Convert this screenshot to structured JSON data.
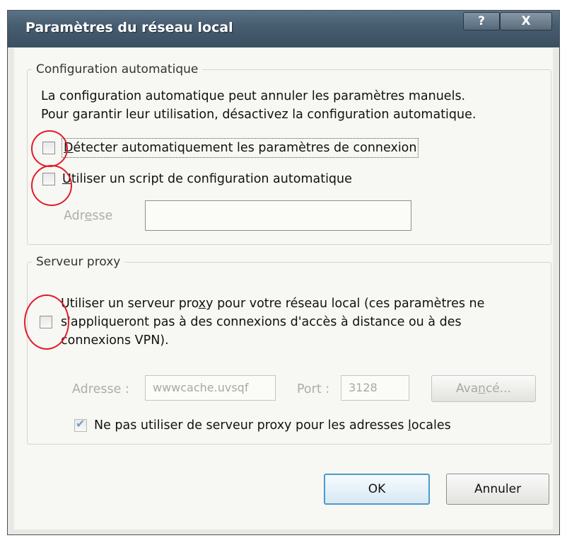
{
  "window": {
    "title": "Paramètres du réseau local",
    "help_label": "?",
    "close_label": "X"
  },
  "auto_config": {
    "legend": "Configuration automatique",
    "description_line1": "La configuration automatique peut annuler les paramètres manuels.",
    "description_line2": "Pour garantir leur utilisation, désactivez la configuration automatique.",
    "detect": {
      "label_first": "D",
      "label_rest": "étecter automatiquement les paramètres de connexion",
      "checked": false
    },
    "script": {
      "label_first": "U",
      "label_rest": "tiliser un script de configuration automatique",
      "checked": false
    },
    "address_label_pre": "Adr",
    "address_label_ul": "e",
    "address_label_post": "sse",
    "address_value": ""
  },
  "proxy": {
    "legend": "Serveur proxy",
    "use_proxy_line1_pre": "Utiliser un serveur pro",
    "use_proxy_line1_ul": "x",
    "use_proxy_line1_post": "y pour votre réseau local (ces paramètres ne",
    "use_proxy_line2": "s'appliqueront pas à des connexions d'accès à distance ou à des",
    "use_proxy_line3": "connexions VPN).",
    "use_proxy_checked": false,
    "address_label": "Adresse :",
    "address_value": "wwwcache.uvsqf",
    "port_label": "Port :",
    "port_value": "3128",
    "advanced_pre": "Ava",
    "advanced_ul": "n",
    "advanced_post": "cé...",
    "bypass_pre": "Ne pas utiliser de serveur proxy pour les adresses ",
    "bypass_ul": "l",
    "bypass_post": "ocales",
    "bypass_checked": true
  },
  "buttons": {
    "ok": "OK",
    "cancel": "Annuler"
  },
  "colors": {
    "annotation_circle": "#e21b2a",
    "titlebar": "#475d70",
    "default_button_border": "#4c9bcc"
  }
}
